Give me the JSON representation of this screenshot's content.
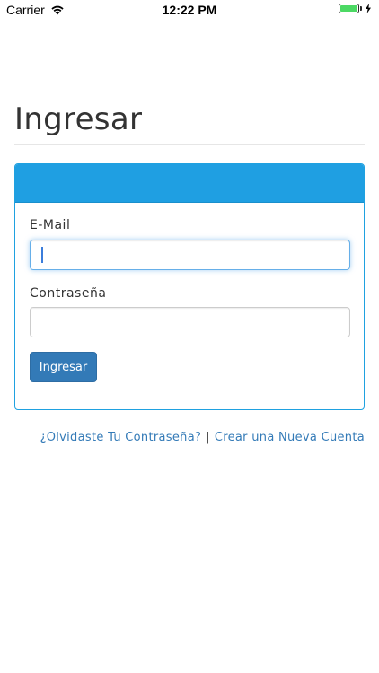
{
  "status_bar": {
    "carrier": "Carrier",
    "time": "12:22 PM",
    "battery_level": 1.0,
    "battery_color": "#4cd964",
    "icons": [
      "wifi-icon",
      "battery-icon",
      "charging-bolt-icon"
    ]
  },
  "page": {
    "title": "Ingresar"
  },
  "form": {
    "header_color": "#1f9fe2",
    "email_label": "E-Mail",
    "email_value": "",
    "password_label": "Contraseña",
    "password_value": "",
    "submit_label": "Ingresar",
    "submit_color": "#337ab7"
  },
  "links": {
    "forgot_password": "¿Olvidaste Tu Contraseña?",
    "separator": "|",
    "create_account": "Crear una Nueva Cuenta",
    "link_color": "#337ab7"
  }
}
